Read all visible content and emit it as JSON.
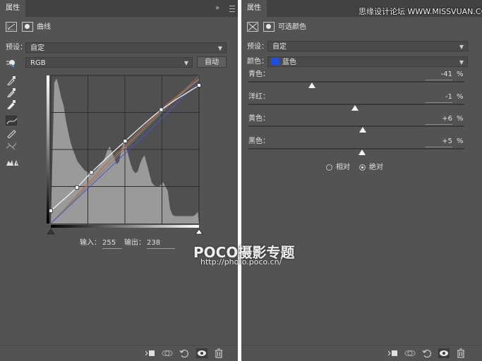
{
  "left_panel": {
    "tab_label": "属性",
    "collapse_glyph": "»",
    "header_title": "曲线",
    "preset_label": "预设：",
    "preset_value": "自定",
    "channel_value": "RGB",
    "auto_button": "自动",
    "tools": [
      "channel-target-icon",
      "black-eyedropper-icon",
      "gray-eyedropper-icon",
      "white-eyedropper-icon",
      "curve-point-icon",
      "pencil-icon",
      "smooth-icon",
      "clipping-warning-icon"
    ],
    "input_label": "输入：",
    "input_value": "255",
    "output_label": "输出：",
    "output_value": "238",
    "curves": {
      "histogram": [
        0.3,
        0.95,
        0.98,
        0.92,
        0.85,
        0.8,
        0.7,
        0.62,
        0.55,
        0.5,
        0.46,
        0.42,
        0.4,
        0.38,
        0.36,
        0.35,
        0.34,
        0.34,
        0.35,
        0.36,
        0.38,
        0.4,
        0.42,
        0.45,
        0.5,
        0.52,
        0.48,
        0.44,
        0.4,
        0.42,
        0.5,
        0.55,
        0.52,
        0.46,
        0.4,
        0.36,
        0.34,
        0.35,
        0.4,
        0.44,
        0.46,
        0.4,
        0.34,
        0.28,
        0.26,
        0.25,
        0.25,
        0.26,
        0.28,
        0.25,
        0.22,
        0.1,
        0.06,
        0.05,
        0.05,
        0.05,
        0.05,
        0.05,
        0.05,
        0.05,
        0.05,
        0.05,
        0.06,
        0.08
      ],
      "rgb_points": [
        [
          0,
          22
        ],
        [
          45,
          62
        ],
        [
          70,
          88
        ],
        [
          128,
          142
        ],
        [
          190,
          196
        ],
        [
          255,
          238
        ]
      ],
      "blue_points": [
        [
          0,
          0
        ],
        [
          90,
          85
        ],
        [
          180,
          170
        ],
        [
          255,
          245
        ]
      ],
      "colors": {
        "rgb": "#f0f0f0",
        "red": "#c85a5a",
        "green": "#8a9a5a",
        "blue": "#4a56c8"
      }
    }
  },
  "right_panel": {
    "tab_label": "属性",
    "header_title": "可选颜色",
    "preset_label": "预设：",
    "preset_value": "自定",
    "colors_label": "颜色：",
    "colors_value": "蓝色",
    "swatch_color": "#1f4fe0",
    "sliders": [
      {
        "label": "青色：",
        "value": "-41",
        "unit": "%",
        "amount": -41
      },
      {
        "label": "洋红：",
        "value": "-1",
        "unit": "%",
        "amount": -1
      },
      {
        "label": "黄色：",
        "value": "+6",
        "unit": "%",
        "amount": 6
      },
      {
        "label": "黑色：",
        "value": "+5",
        "unit": "%",
        "amount": 5
      }
    ],
    "method_relative": "相对",
    "method_absolute": "绝对",
    "method_selected": "absolute"
  },
  "bottom_icons": [
    "clip-to-layer-icon",
    "view-previous-icon",
    "reset-icon",
    "visibility-eye-icon",
    "trash-icon"
  ],
  "watermarks": {
    "top": "思缘设计论坛 WWW.MISSVUAN.COM",
    "poco": "POCO摄影专题",
    "url": "http://photo.poco.cn/"
  }
}
